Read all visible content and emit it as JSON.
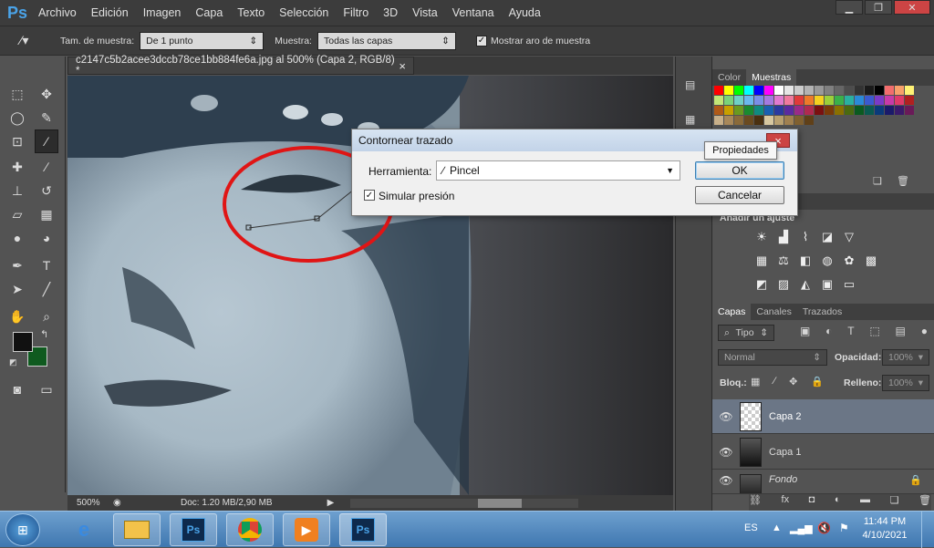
{
  "app": {
    "logo": "Ps"
  },
  "menu": [
    "Archivo",
    "Edición",
    "Imagen",
    "Capa",
    "Texto",
    "Selección",
    "Filtro",
    "3D",
    "Vista",
    "Ventana",
    "Ayuda"
  ],
  "window_controls": {
    "minimize": "▁",
    "restore": "❐",
    "close": "✕"
  },
  "options": {
    "sample_size_label": "Tam. de muestra:",
    "sample_size_value": "De 1 punto",
    "sample_label": "Muestra:",
    "sample_value": "Todas las capas",
    "show_ring_label": "Mostrar aro de muestra",
    "show_ring_checked": true
  },
  "document": {
    "tab_title": "c2147c5b2acee3dccb78ce1bb884fe6a.jpg al 500% (Capa 2, RGB/8) *",
    "close": "×",
    "zoom": "500%",
    "doc_info": "Doc: 1.20 MB/2,90 MB"
  },
  "colors": {
    "foreground": "#111111",
    "background": "#0f5a1f",
    "annotation_circle": "#e01515"
  },
  "swatch_panel": {
    "tabs": [
      "Color",
      "Muestras"
    ],
    "active_tab": "Muestras"
  },
  "swatches": [
    [
      "#ff0000",
      "#ffff00",
      "#00ff00",
      "#00ffff",
      "#0000ff",
      "#ff00ff",
      "#ffffff",
      "#e6e6e6",
      "#cccccc",
      "#b3b3b3",
      "#999999",
      "#808080",
      "#666666",
      "#4d4d4d",
      "#333333",
      "#1a1a1a",
      "#000000",
      "#f26d6d",
      "#f8a06a",
      "#fff275"
    ],
    [
      "#c2e677",
      "#7ad37a",
      "#6fd0c6",
      "#6ab8ee",
      "#7a8ee8",
      "#a57ae0",
      "#e07ad0",
      "#f07a9e",
      "#e03a3a",
      "#ee7a2a",
      "#f5d020",
      "#9cd03a",
      "#3ab04a",
      "#2ab0a0",
      "#2a8ad8",
      "#3a5ad0",
      "#7a3ac8",
      "#c83aa8",
      "#e03a6a",
      "#b02020"
    ],
    [
      "#b05a18",
      "#c8a000",
      "#6a9a20",
      "#1a8a30",
      "#108a80",
      "#1a60b0",
      "#2a3aa0",
      "#5a2aa0",
      "#9a2a88",
      "#b02a50",
      "#7a1010",
      "#7a3a08",
      "#8a7000",
      "#4a6a10",
      "#0a5a20",
      "#0a5a50",
      "#0a3a7a",
      "#1a1a6a",
      "#3a1a6a",
      "#6a1a58"
    ],
    [
      "#c8b08a",
      "#a8885a",
      "#8a6a3a",
      "#6a4a20",
      "#4a3010",
      "#d8c8a0",
      "#b8a070",
      "#a08050",
      "#806030",
      "#604018"
    ]
  ],
  "adjustments_title": "Añadir un ajuste",
  "adjust_icons": [
    [
      "brightness-icon",
      "levels-icon",
      "curves-icon",
      "exposure-icon",
      "vibrance-triangle-icon"
    ],
    [
      "hue-saturation-icon",
      "color-balance-icon",
      "black-white-icon",
      "photo-filter-icon",
      "channel-mixer-icon",
      "color-lookup-icon"
    ],
    [
      "invert-icon",
      "posterize-icon",
      "threshold-icon",
      "selective-color-icon",
      "gradient-map-icon"
    ]
  ],
  "layers_panel": {
    "tabs": [
      "Capas",
      "Canales",
      "Trazados"
    ],
    "active_tab": "Capas",
    "filter_kind": "Tipo",
    "blend_mode": "Normal",
    "opacity_label": "Opacidad:",
    "opacity_value": "100%",
    "lock_label": "Bloq.:",
    "fill_label": "Relleno:",
    "fill_value": "100%",
    "layers": [
      {
        "name": "Capa 2",
        "selected": true,
        "transparent": true
      },
      {
        "name": "Capa 1",
        "selected": false,
        "transparent": false
      },
      {
        "name": "Fondo",
        "selected": false,
        "transparent": false,
        "locked": true
      }
    ]
  },
  "dialog": {
    "title": "Contornear trazado",
    "close": "×",
    "tool_label": "Herramienta:",
    "tool_value": "Pincel",
    "simulate_pressure_label": "Simular presión",
    "simulate_pressure_checked": true,
    "ok": "OK",
    "cancel": "Cancelar",
    "tooltip": "Propiedades"
  },
  "taskbar": {
    "language": "ES",
    "time": "11:44 PM",
    "date": "4/10/2021"
  }
}
